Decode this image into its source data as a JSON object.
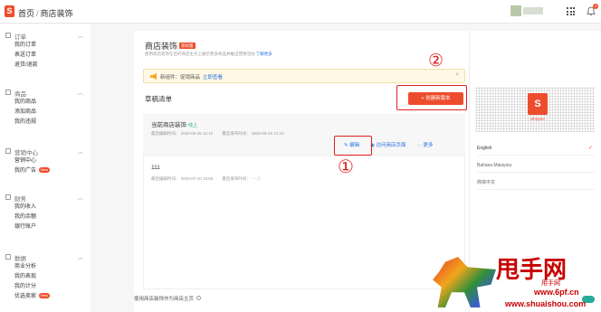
{
  "header": {
    "logo_text": "S",
    "breadcrumb_home": "首页",
    "breadcrumb_sep": "/",
    "breadcrumb_current": "商店装饰",
    "notification_count": "3"
  },
  "sidebar": {
    "sections": [
      {
        "title": "订单",
        "items": [
          "我的订单",
          "表送订单",
          "退货/退款"
        ]
      },
      {
        "title": "商品",
        "items": [
          "我的商品",
          "添加商品",
          "我的违规"
        ]
      },
      {
        "title": "营销中心",
        "items": [
          "营销中心",
          "我的广告"
        ],
        "new_item_index": 1,
        "new_badge": "New"
      },
      {
        "title": "财务",
        "items": [
          "我的收入",
          "我的余额",
          "银行账户"
        ]
      },
      {
        "title": "数据",
        "items": [
          "商业分析",
          "我的表现",
          "我的计分",
          "优选卖家"
        ],
        "new_item_index": 3,
        "new_badge": "New"
      }
    ]
  },
  "main": {
    "title": "商店装饰",
    "title_badge": "测试版",
    "subtitle": "使用商店装饰在您的商店主页上展示更多商品并推出营销活动",
    "learn_more": "了解更多",
    "notice_text": "新组件：促销商品",
    "notice_link": "立即查看",
    "notice_close": "×",
    "drafts_title": "草稿清单",
    "create_button": "+ 创建新版本",
    "current": {
      "title": "当前商店装饰",
      "status": "线上",
      "last_edit": "最后编辑时间：   2020-05-25 12:10",
      "last_publish": "最后发布时间：   2020-05-25 12:10",
      "edit": "✎ 编辑",
      "visit": "◉ 访问商店页面",
      "more": "··· 更多"
    },
    "draft": {
      "title": "111",
      "last_edit": "最后编辑时间：   2020-07-10 10:55",
      "last_publish": "最后发布时间：   - - ⓘ"
    },
    "bottom_text": "使用商店装饰作为商店主页"
  },
  "annotations": {
    "circle1": "①",
    "circle2": "②"
  },
  "preview": {
    "shopee_label": "Shopee",
    "languages": [
      "English",
      "Bahasa Malaysia",
      "简体中文"
    ],
    "selected_language": "English"
  },
  "watermark": {
    "big": "甩手网",
    "sub1": "用手网",
    "sub2": "www.6pf.cn",
    "sub3": "www.shuaishou.com"
  },
  "colors": {
    "brand": "#ee4d2d",
    "link": "#2673dd",
    "success": "#26aa99",
    "annotation": "#e02020"
  }
}
